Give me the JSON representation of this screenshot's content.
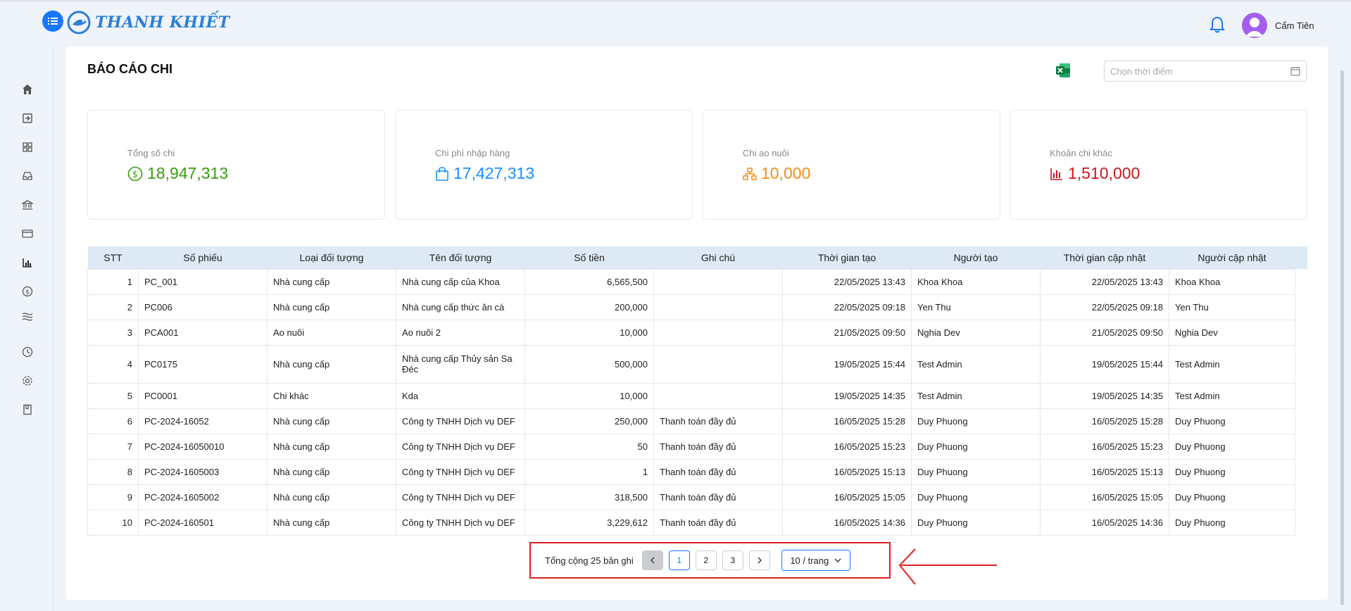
{
  "app": {
    "logo_text": "THANH KHIẾT",
    "username": "Cẩm Tiên"
  },
  "colors": {
    "accent": "#1677ff",
    "green": "#389e0d",
    "blue": "#1890ff",
    "orange": "#fa8c16",
    "red": "#cf1322"
  },
  "sidebar": {
    "icons": [
      "home-icon",
      "import-icon",
      "grid-icon",
      "inbox-icon",
      "bank-icon",
      "card-icon",
      "bar-chart-icon",
      "dollar-icon",
      "water-icon",
      "history-icon",
      "gear-icon",
      "book-icon"
    ]
  },
  "page": {
    "title": "BÁO CÁO CHI",
    "date_placeholder": "Chọn thời điểm"
  },
  "stats": [
    {
      "label": "Tổng số chi",
      "value": "18,947,313",
      "icon": "dollar-circle-icon"
    },
    {
      "label": "Chi phí nhập hàng",
      "value": "17,427,313",
      "icon": "shopping-bag-icon"
    },
    {
      "label": "Chi ao nuôi",
      "value": "10,000",
      "icon": "cluster-icon"
    },
    {
      "label": "Khoản chi khác",
      "value": "1,510,000",
      "icon": "bar-chart-icon"
    }
  ],
  "table": {
    "headers": [
      "STT",
      "Số phiếu",
      "Loại đối tượng",
      "Tên đối tượng",
      "Số tiền",
      "Ghi chú",
      "Thời gian tạo",
      "Người tạo",
      "Thời gian cập nhật",
      "Người cập nhật"
    ],
    "rows": [
      [
        "1",
        "PC_001",
        "Nhà cung cấp",
        "Nhà cung cấp của Khoa",
        "6,565,500",
        "",
        "22/05/2025 13:43",
        "Khoa Khoa",
        "22/05/2025 13:43",
        "Khoa Khoa"
      ],
      [
        "2",
        "PC006",
        "Nhà cung cấp",
        "Nhà cung cấp thức ăn cá",
        "200,000",
        "",
        "22/05/2025 09:18",
        "Yen Thu",
        "22/05/2025 09:18",
        "Yen Thu"
      ],
      [
        "3",
        "PCA001",
        "Ao nuôi",
        "Ao nuôi 2",
        "10,000",
        "",
        "21/05/2025 09:50",
        "Nghia Dev",
        "21/05/2025 09:50",
        "Nghia Dev"
      ],
      [
        "4",
        "PC0175",
        "Nhà cung cấp",
        "Nhà cung cấp Thủy sản Sa Đéc",
        "500,000",
        "",
        "19/05/2025 15:44",
        "Test Admin",
        "19/05/2025 15:44",
        "Test Admin"
      ],
      [
        "5",
        "PC0001",
        "Chi khác",
        "Kda",
        "10,000",
        "",
        "19/05/2025 14:35",
        "Test Admin",
        "19/05/2025 14:35",
        "Test Admin"
      ],
      [
        "6",
        "PC-2024-16052",
        "Nhà cung cấp",
        "Công ty TNHH Dịch vụ DEF",
        "250,000",
        "Thanh toán đầy đủ",
        "16/05/2025 15:28",
        "Duy Phuong",
        "16/05/2025 15:28",
        "Duy Phuong"
      ],
      [
        "7",
        "PC-2024-16050010",
        "Nhà cung cấp",
        "Công ty TNHH Dịch vụ DEF",
        "50",
        "Thanh toán đầy đủ",
        "16/05/2025 15:23",
        "Duy Phuong",
        "16/05/2025 15:23",
        "Duy Phuong"
      ],
      [
        "8",
        "PC-2024-1605003",
        "Nhà cung cấp",
        "Công ty TNHH Dịch vụ DEF",
        "1",
        "Thanh toán đầy đủ",
        "16/05/2025 15:13",
        "Duy Phuong",
        "16/05/2025 15:13",
        "Duy Phuong"
      ],
      [
        "9",
        "PC-2024-1605002",
        "Nhà cung cấp",
        "Công ty TNHH Dịch vụ DEF",
        "318,500",
        "Thanh toán đầy đủ",
        "16/05/2025 15:05",
        "Duy Phuong",
        "16/05/2025 15:05",
        "Duy Phuong"
      ],
      [
        "10",
        "PC-2024-160501",
        "Nhà cung cấp",
        "Công ty TNHH Dịch vụ DEF",
        "3,229,612",
        "Thanh toán đầy đủ",
        "16/05/2025 14:36",
        "Duy Phuong",
        "16/05/2025 14:36",
        "Duy Phuong"
      ]
    ]
  },
  "pagination": {
    "total_text": "Tổng cộng 25 bản ghi",
    "pages": [
      "1",
      "2",
      "3"
    ],
    "current": "1",
    "page_size": "10 / trang"
  }
}
